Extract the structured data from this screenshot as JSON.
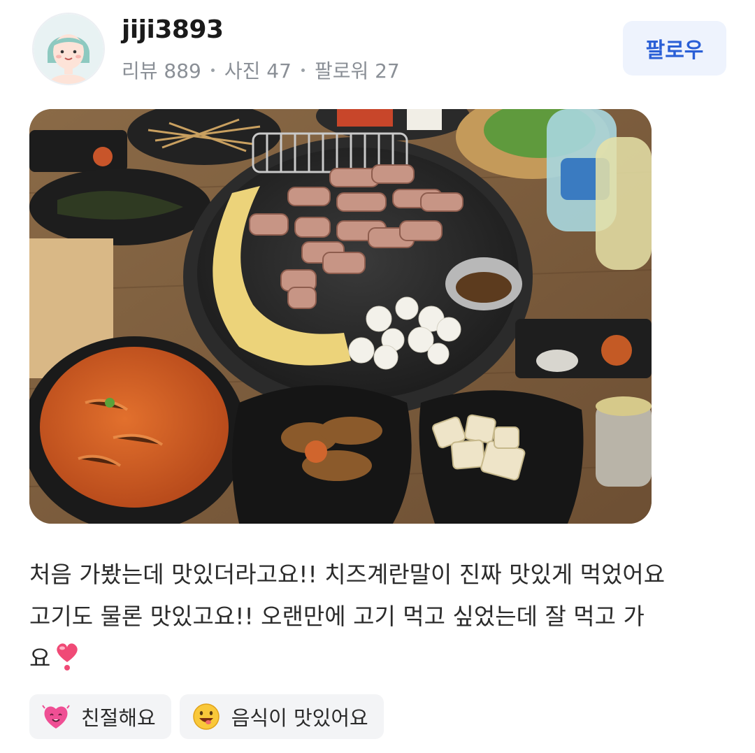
{
  "profile": {
    "username": "jiji3893",
    "stats": [
      {
        "label": "리뷰",
        "value": "889"
      },
      {
        "label": "사진",
        "value": "47"
      },
      {
        "label": "팔로워",
        "value": "27"
      }
    ],
    "stats_text": [
      "리뷰 889",
      "사진 47",
      "팔로워 27"
    ],
    "follow_label": "팔로우",
    "avatar_icon": "avatar-girl-icon"
  },
  "review": {
    "photo_icon": "food-photo-korean-bbq",
    "lines": [
      "처음 가봤는데 맛있더라고요!! 치즈계란말이 진짜 맛있게 먹었어요",
      "고기도 물론 맛있고요!! 오랜만에 고기 먹고 싶었는데 잘 먹고 가",
      "요"
    ],
    "emoji": "❣️"
  },
  "tags": [
    {
      "label": "친절해요",
      "icon": "heart-face-icon"
    },
    {
      "label": "음식이 맛있어요",
      "icon": "yum-face-icon"
    }
  ],
  "colors": {
    "follow_bg": "#eef3fd",
    "follow_text": "#2a5fd6",
    "tag_bg": "#f3f4f6"
  }
}
